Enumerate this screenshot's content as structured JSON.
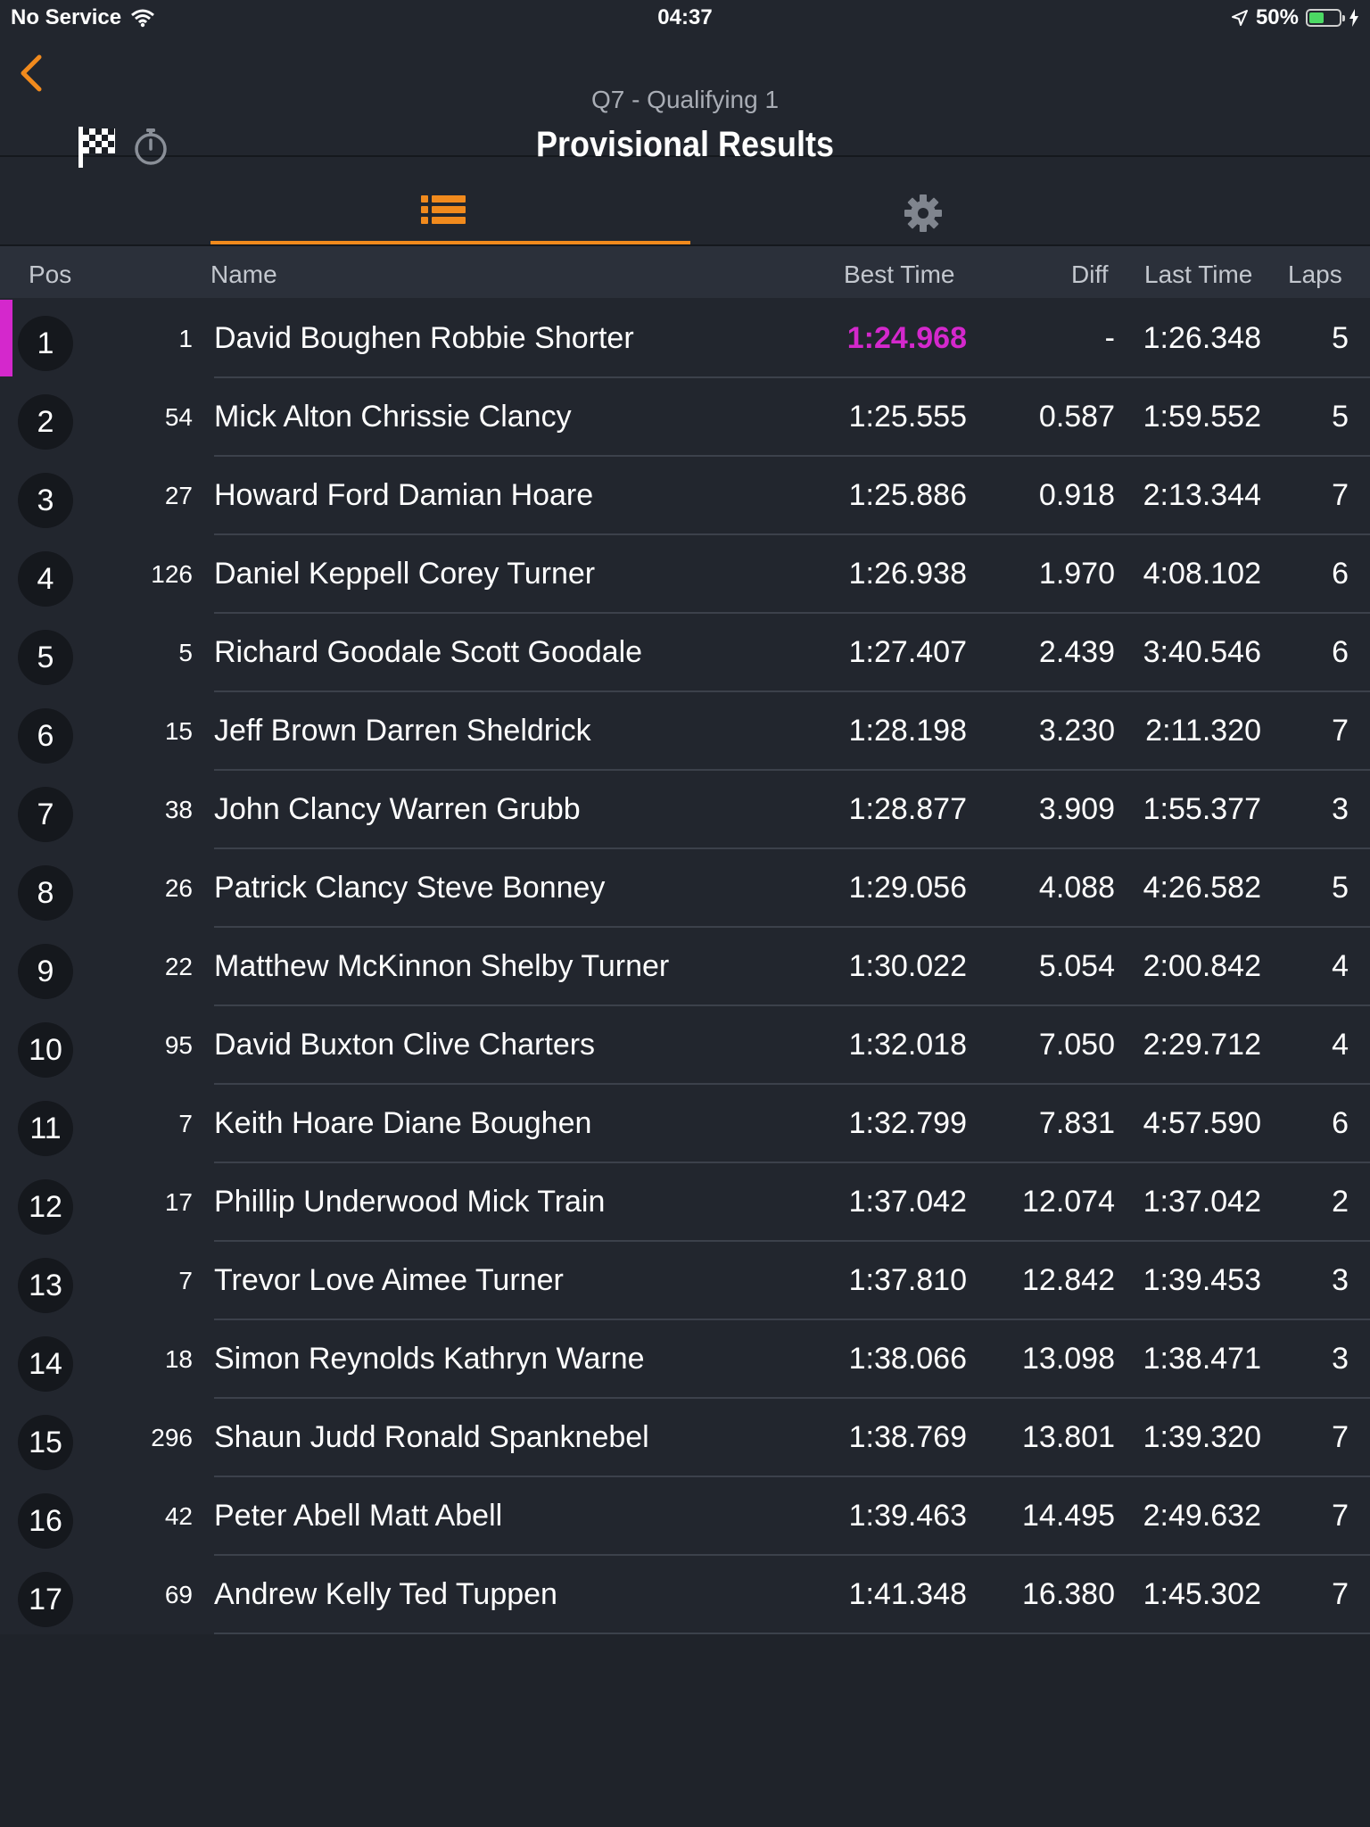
{
  "status_bar": {
    "carrier": "No Service",
    "time": "04:37",
    "battery": "50%",
    "battery_level": 0.5
  },
  "header": {
    "subtitle": "Q7 - Qualifying 1",
    "title": "Provisional Results",
    "accent_color": "#f18a1d"
  },
  "tabs": [
    {
      "icon": "list-icon",
      "active": true
    },
    {
      "icon": "gear-icon",
      "active": false
    }
  ],
  "columns": {
    "pos": "Pos",
    "name": "Name",
    "best_time": "Best Time",
    "diff": "Diff",
    "last_time": "Last Time",
    "laps": "Laps"
  },
  "highlight_color": "#d428cc",
  "results": [
    {
      "pos": "1",
      "num": "1",
      "name": "David Boughen Robbie Shorter",
      "best": "1:24.968",
      "diff": "-",
      "last": "1:26.348",
      "laps": "5"
    },
    {
      "pos": "2",
      "num": "54",
      "name": "Mick Alton Chrissie Clancy",
      "best": "1:25.555",
      "diff": "0.587",
      "last": "1:59.552",
      "laps": "5"
    },
    {
      "pos": "3",
      "num": "27",
      "name": "Howard Ford Damian Hoare",
      "best": "1:25.886",
      "diff": "0.918",
      "last": "2:13.344",
      "laps": "7"
    },
    {
      "pos": "4",
      "num": "126",
      "name": "Daniel Keppell Corey Turner",
      "best": "1:26.938",
      "diff": "1.970",
      "last": "4:08.102",
      "laps": "6"
    },
    {
      "pos": "5",
      "num": "5",
      "name": "Richard Goodale Scott Goodale",
      "best": "1:27.407",
      "diff": "2.439",
      "last": "3:40.546",
      "laps": "6"
    },
    {
      "pos": "6",
      "num": "15",
      "name": "Jeff Brown Darren Sheldrick",
      "best": "1:28.198",
      "diff": "3.230",
      "last": "2:11.320",
      "laps": "7"
    },
    {
      "pos": "7",
      "num": "38",
      "name": "John Clancy Warren Grubb",
      "best": "1:28.877",
      "diff": "3.909",
      "last": "1:55.377",
      "laps": "3"
    },
    {
      "pos": "8",
      "num": "26",
      "name": "Patrick Clancy Steve Bonney",
      "best": "1:29.056",
      "diff": "4.088",
      "last": "4:26.582",
      "laps": "5"
    },
    {
      "pos": "9",
      "num": "22",
      "name": "Matthew McKinnon Shelby Turner",
      "best": "1:30.022",
      "diff": "5.054",
      "last": "2:00.842",
      "laps": "4"
    },
    {
      "pos": "10",
      "num": "95",
      "name": "David Buxton Clive Charters",
      "best": "1:32.018",
      "diff": "7.050",
      "last": "2:29.712",
      "laps": "4"
    },
    {
      "pos": "11",
      "num": "7",
      "name": "Keith Hoare Diane Boughen",
      "best": "1:32.799",
      "diff": "7.831",
      "last": "4:57.590",
      "laps": "6"
    },
    {
      "pos": "12",
      "num": "17",
      "name": "Phillip Underwood Mick Train",
      "best": "1:37.042",
      "diff": "12.074",
      "last": "1:37.042",
      "laps": "2"
    },
    {
      "pos": "13",
      "num": "7",
      "name": "Trevor Love Aimee Turner",
      "best": "1:37.810",
      "diff": "12.842",
      "last": "1:39.453",
      "laps": "3"
    },
    {
      "pos": "14",
      "num": "18",
      "name": "Simon Reynolds Kathryn Warne",
      "best": "1:38.066",
      "diff": "13.098",
      "last": "1:38.471",
      "laps": "3"
    },
    {
      "pos": "15",
      "num": "296",
      "name": "Shaun Judd Ronald Spanknebel",
      "best": "1:38.769",
      "diff": "13.801",
      "last": "1:39.320",
      "laps": "7"
    },
    {
      "pos": "16",
      "num": "42",
      "name": "Peter Abell Matt Abell",
      "best": "1:39.463",
      "diff": "14.495",
      "last": "2:49.632",
      "laps": "7"
    },
    {
      "pos": "17",
      "num": "69",
      "name": "Andrew Kelly Ted Tuppen",
      "best": "1:41.348",
      "diff": "16.380",
      "last": "1:45.302",
      "laps": "7"
    }
  ]
}
